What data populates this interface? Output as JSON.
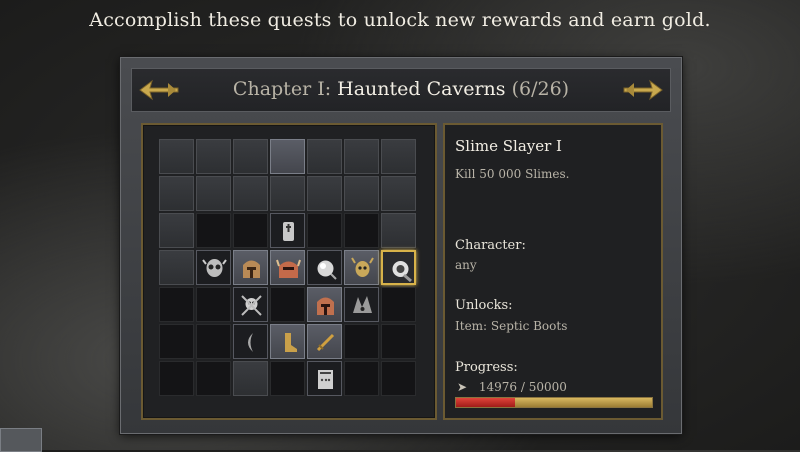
{
  "instruction": "Accomplish these quests to unlock new rewards and earn gold.",
  "chapter": {
    "prefix": "Chapter I:",
    "name": "Haunted Caverns",
    "count": "(6/26)"
  },
  "quest": {
    "title": "Slime Slayer I",
    "description": "Kill 50 000 Slimes.",
    "character_label": "Character:",
    "character_value": "any",
    "unlocks_label": "Unlocks:",
    "unlocks_value": "Item: Septic Boots",
    "progress_label": "Progress:",
    "progress_text": "14976 / 50000",
    "progress_fraction": 0.2995
  },
  "colors": {
    "accent_gold": "#d8b34a",
    "progress_red": "#c0302a",
    "panel_border": "#6b5a32"
  },
  "grid": [
    [
      "lit",
      "lit",
      "lit",
      "done",
      "lit",
      "lit",
      "lit"
    ],
    [
      "lit",
      "lit",
      "lit",
      "lit",
      "lit",
      "lit",
      "lit"
    ],
    [
      "lit",
      "empty",
      "empty",
      "quest:coffin",
      "empty",
      "empty",
      "lit"
    ],
    [
      "lit",
      "quest:skull-mask",
      "done:helmet-a",
      "done:helmet-b",
      "quest:orb",
      "done:demon-face",
      "selected:slime"
    ],
    [
      "empty",
      "empty",
      "quest:skull-crossbones",
      "empty",
      "done:helmet-c",
      "quest:dark-eye",
      "empty"
    ],
    [
      "empty",
      "empty",
      "quest:crescent",
      "done:boot",
      "done:sword",
      "empty",
      "empty"
    ],
    [
      "empty",
      "empty",
      "lit",
      "empty",
      "quest:tome",
      "empty",
      "empty"
    ]
  ]
}
